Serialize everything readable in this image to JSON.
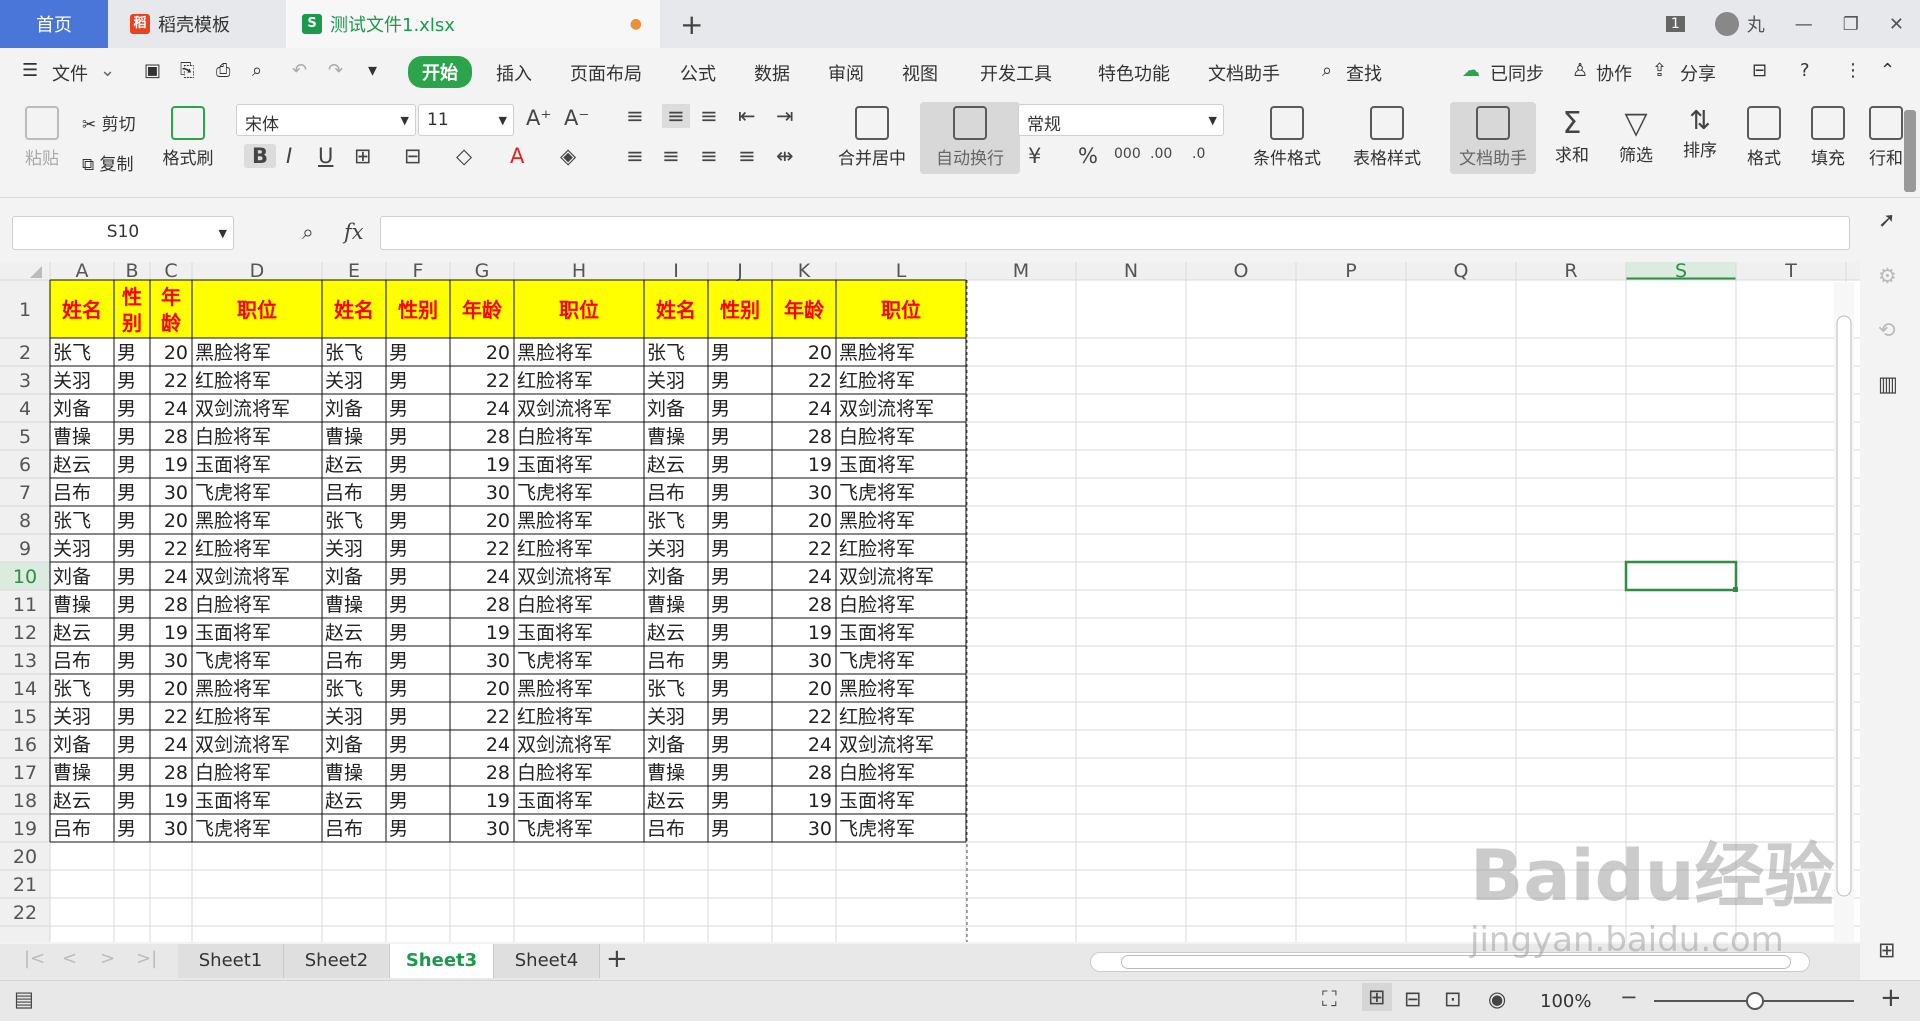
{
  "tabs": {
    "home": "首页",
    "docer": "稻壳模板",
    "file": "测试文件1.xlsx",
    "new": "+"
  },
  "user": {
    "badge": "1",
    "name": "丸"
  },
  "menu": [
    "文件",
    "开始",
    "插入",
    "页面布局",
    "公式",
    "数据",
    "审阅",
    "视图",
    "开发工具",
    "特色功能",
    "文档助手",
    "查找"
  ],
  "menu_right": [
    "已同步",
    "协作",
    "分享"
  ],
  "ribbon": {
    "paste": "粘贴",
    "cut": "剪切",
    "copy": "复制",
    "format_painter": "格式刷",
    "font": "宋体",
    "size": "11",
    "merge": "合并居中",
    "wrap": "自动换行",
    "numfmt": "常规",
    "cond": "条件格式",
    "tablestyle": "表格样式",
    "assistant": "文档助手",
    "sum": "求和",
    "filter": "筛选",
    "sort": "排序",
    "format": "格式",
    "fill": "填充",
    "rowcol": "行和"
  },
  "formula": {
    "namebox": "S10",
    "fx": "fx",
    "value": ""
  },
  "columns": [
    "A",
    "B",
    "C",
    "D",
    "E",
    "F",
    "G",
    "H",
    "I",
    "J",
    "K",
    "L",
    "M",
    "N",
    "O",
    "P",
    "Q",
    "R",
    "S",
    "T"
  ],
  "header_row": [
    "姓名",
    "性别",
    "年龄",
    "职位",
    "姓名",
    "性别",
    "年龄",
    "职位",
    "姓名",
    "性别",
    "年龄",
    "职位"
  ],
  "rows": [
    [
      "张飞",
      "男",
      "20",
      "黑脸将军"
    ],
    [
      "关羽",
      "男",
      "22",
      "红脸将军"
    ],
    [
      "刘备",
      "男",
      "24",
      "双剑流将军"
    ],
    [
      "曹操",
      "男",
      "28",
      "白脸将军"
    ],
    [
      "赵云",
      "男",
      "19",
      "玉面将军"
    ],
    [
      "吕布",
      "男",
      "30",
      "飞虎将军"
    ],
    [
      "张飞",
      "男",
      "20",
      "黑脸将军"
    ],
    [
      "关羽",
      "男",
      "22",
      "红脸将军"
    ],
    [
      "刘备",
      "男",
      "24",
      "双剑流将军"
    ],
    [
      "曹操",
      "男",
      "28",
      "白脸将军"
    ],
    [
      "赵云",
      "男",
      "19",
      "玉面将军"
    ],
    [
      "吕布",
      "男",
      "30",
      "飞虎将军"
    ],
    [
      "张飞",
      "男",
      "20",
      "黑脸将军"
    ],
    [
      "关羽",
      "男",
      "22",
      "红脸将军"
    ],
    [
      "刘备",
      "男",
      "24",
      "双剑流将军"
    ],
    [
      "曹操",
      "男",
      "28",
      "白脸将军"
    ],
    [
      "赵云",
      "男",
      "19",
      "玉面将军"
    ],
    [
      "吕布",
      "男",
      "30",
      "飞虎将军"
    ]
  ],
  "sheet_tabs": [
    "Sheet1",
    "Sheet2",
    "Sheet3",
    "Sheet4"
  ],
  "active_sheet": "Sheet3",
  "zoom": "100%",
  "watermark": {
    "logo": "Baidu经验",
    "url": "jingyan.baidu.com"
  },
  "colors": {
    "header_fill": "#ffff00",
    "header_text": "#ff0000",
    "accent": "#1a9a4b",
    "home_tab": "#4a76d9",
    "selection": "#2d8f43"
  }
}
